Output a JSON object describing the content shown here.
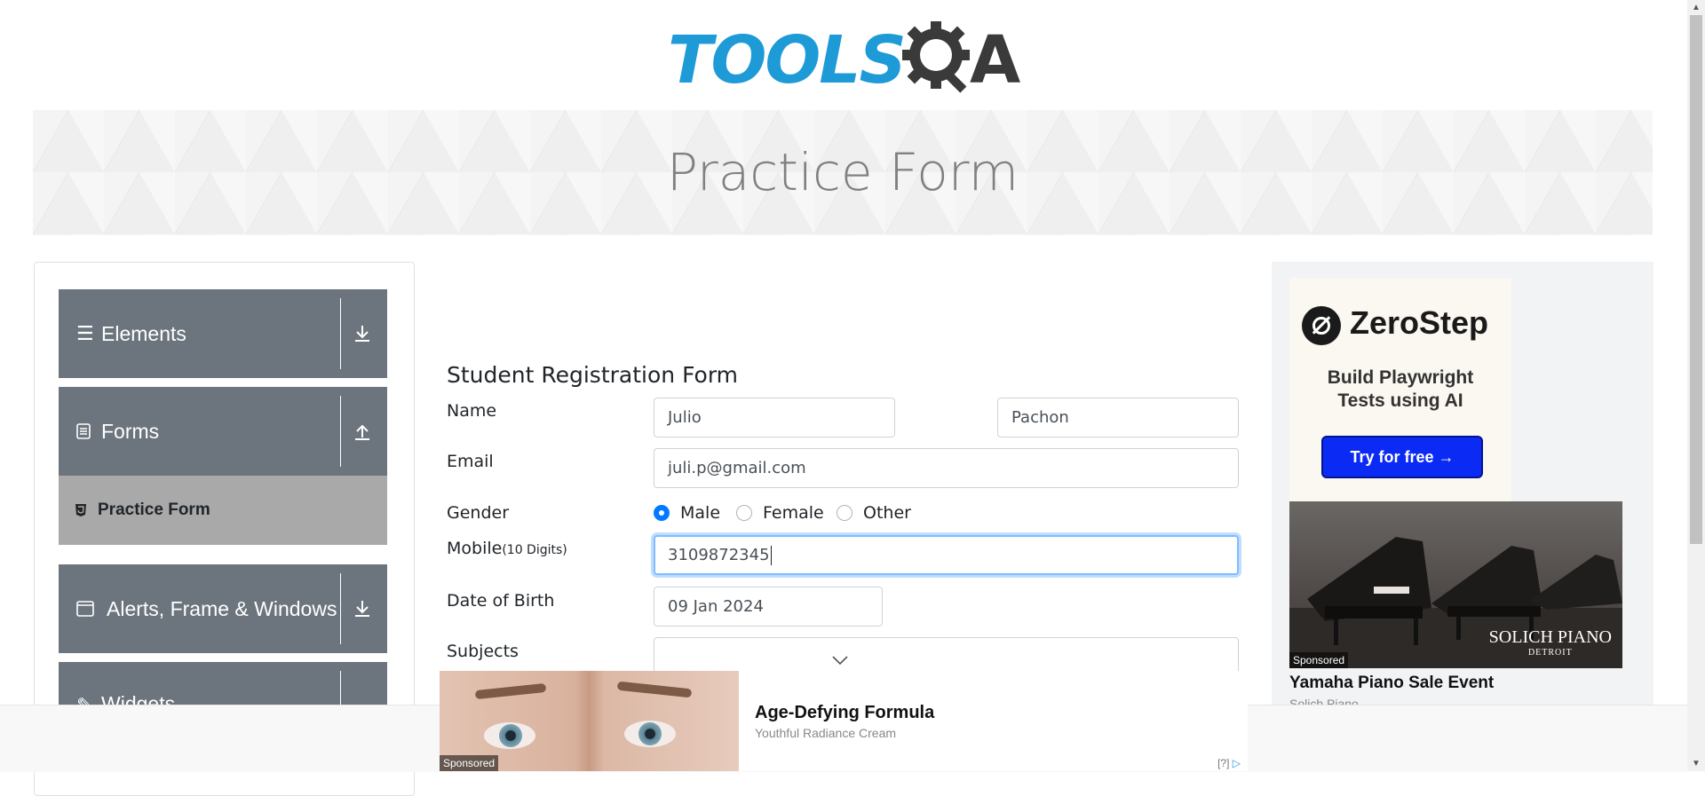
{
  "logo": {
    "text": "TOOLS",
    "letter": "A",
    "icon": "gear-magnifier-icon"
  },
  "banner": {
    "title": "Practice Form"
  },
  "sidebar": {
    "groups": [
      {
        "label": "Elements",
        "icon": "hamburger-icon",
        "arrow": "download-icon"
      },
      {
        "label": "Forms",
        "icon": "document-icon",
        "arrow": "upload-icon"
      },
      {
        "label": "Alerts, Frame & Windows",
        "icon": "window-icon",
        "arrow": "download-icon"
      },
      {
        "label": "Widgets",
        "icon": "widget-icon",
        "arrow": "download-icon"
      }
    ],
    "active_item": {
      "label": "Practice Form",
      "icon": "html5-icon"
    }
  },
  "form": {
    "title": "Student Registration Form",
    "name_label": "Name",
    "first_name": "Julio",
    "last_name": "Pachon",
    "email_label": "Email",
    "email": "juli.p@gmail.com",
    "gender_label": "Gender",
    "gender_options": [
      "Male",
      "Female",
      "Other"
    ],
    "gender_selected": "Male",
    "mobile_label": "Mobile",
    "mobile_hint": "(10 Digits)",
    "mobile": "3109872345",
    "dob_label": "Date of Birth",
    "dob": "09 Jan 2024",
    "subjects_label": "Subjects",
    "subjects_value": ""
  },
  "right_ad": {
    "brand": "ZeroStep",
    "subtitle_line1": "Build Playwright",
    "subtitle_line2": "Tests using AI",
    "cta": "Try for free →",
    "image_sponsored": "Sponsored",
    "image_brand": "SOLICH PIANO",
    "image_brand_sub": "DETROIT",
    "headline": "Yamaha Piano Sale Event",
    "advertiser": "Solich Piano"
  },
  "bottom_ad": {
    "sponsored": "Sponsored",
    "headline": "Age-Defying Formula",
    "sub": "Youthful Radiance Cream",
    "adchoices": "[?]"
  },
  "colors": {
    "brand_blue": "#1e9ad6",
    "sidebar_bg": "#6c757d",
    "active_item_bg": "#a9a9a9",
    "cta_blue": "#0b2bf5",
    "radio_checked": "#007bff"
  }
}
